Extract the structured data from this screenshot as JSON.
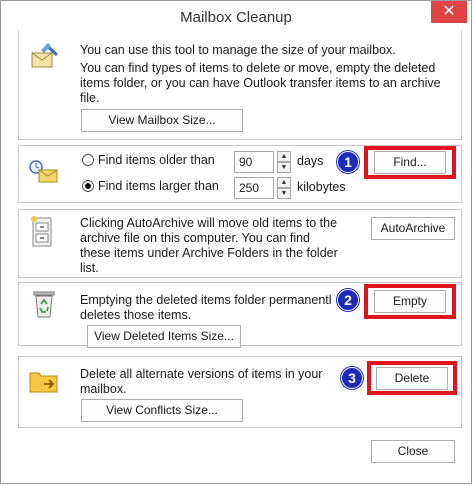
{
  "window": {
    "title": "Mailbox Cleanup"
  },
  "mailbox_size": {
    "description": "You can use this tool to manage the size of your mailbox.",
    "description2_lines": [
      "You can find types of items to delete or move, empty the deleted",
      "items folder, or you can have Outlook transfer items to an archive",
      "file."
    ],
    "button_label": "View Mailbox Size..."
  },
  "find": {
    "older_label": "Find items older than",
    "older_value": "90",
    "older_unit": "days",
    "larger_label": "Find items larger than",
    "larger_value": "250",
    "larger_unit": "kilobytes",
    "selected_option": "larger",
    "button_label": "Find...",
    "badge": "1"
  },
  "autoarchive": {
    "description_lines": [
      "Clicking AutoArchive will move old items to the",
      "archive file on this computer. You can find",
      "these items under Archive Folders in the folder",
      "list."
    ],
    "button_label": "AutoArchive"
  },
  "deleted_items": {
    "description_lines": [
      "Emptying the deleted items folder permanentl",
      "deletes those items."
    ],
    "button_label": "Empty",
    "view_button_label": "View Deleted Items Size...",
    "badge": "2"
  },
  "conflicts": {
    "description_lines": [
      "Delete all alternate versions of items in your",
      "mailbox."
    ],
    "button_label": "Delete",
    "view_button_label": "View Conflicts Size...",
    "badge": "3"
  },
  "footer": {
    "close_label": "Close"
  },
  "colors": {
    "highlight": "#e0141e",
    "badge": "#1e2bb8",
    "close_x": "#e04343"
  }
}
